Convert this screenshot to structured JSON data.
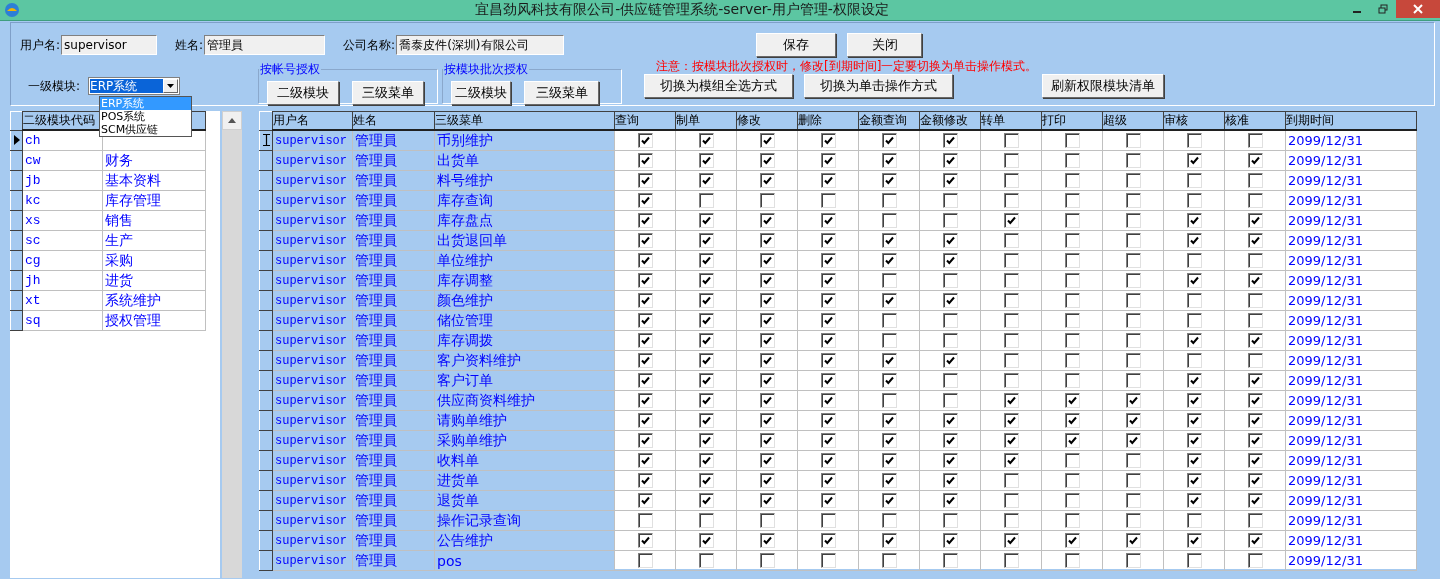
{
  "window": {
    "title": "宜昌劲风科技有限公司-供应链管理系统-server-用户管理-权限设定"
  },
  "fields": [
    {
      "label": "用户名:",
      "value": "supervisor"
    },
    {
      "label": "姓名:",
      "value": "管理員"
    },
    {
      "label": "公司名称:",
      "value": "喬泰皮件(深圳)有限公司"
    }
  ],
  "actions": [
    "保存",
    "关闭"
  ],
  "module": {
    "label": "一级模块:",
    "value": "ERP系统",
    "options": [
      {
        "label": "ERP系统",
        "selected": true
      },
      {
        "label": "POS系统",
        "selected": false
      },
      {
        "label": "SCM供应链",
        "selected": false
      }
    ]
  },
  "groups": [
    {
      "title": "按帐号授权",
      "buttons": [
        "二级模块",
        "三级菜单"
      ]
    },
    {
      "title": "按模块批次授权",
      "buttons": [
        "二级模块",
        "三级菜单"
      ]
    }
  ],
  "notice": "注意：按模块批次授权时，修改[到期时间]一定要切换为单击操作模式。",
  "mode_buttons": [
    "切换为模组全选方式",
    "切换为单击操作方式",
    "刷新权限模块清单"
  ],
  "module_grid": {
    "columns": [
      "二级模块代码"
    ],
    "rows": [
      {
        "code": "ch",
        "selected": true
      },
      {
        "code": "cw",
        "name": "财务",
        "selected": false
      },
      {
        "code": "jb",
        "name": "基本资料",
        "selected": false
      },
      {
        "code": "kc",
        "name": "库存管理",
        "selected": false
      },
      {
        "code": "xs",
        "name": "销售",
        "selected": false
      },
      {
        "code": "sc",
        "name": "生产",
        "selected": false
      },
      {
        "code": "cg",
        "name": "采购",
        "selected": false
      },
      {
        "code": "jh",
        "name": "进货",
        "selected": false
      },
      {
        "code": "xt",
        "name": "系统维护",
        "selected": false
      },
      {
        "code": "sq",
        "name": "授权管理",
        "selected": false
      }
    ]
  },
  "permissions": {
    "columns": [
      "用户名",
      "姓名",
      "三级菜单",
      "查询",
      "制单",
      "修改",
      "删除",
      "金额查询",
      "金额修改",
      "转单",
      "打印",
      "超级",
      "审核",
      "核准",
      "到期时间"
    ],
    "rows": [
      {
        "user": "supervisor",
        "name": "管理員",
        "menu": "币别维护",
        "selected": true,
        "checks": [
          true,
          true,
          true,
          true,
          true,
          true,
          false,
          false,
          false,
          false,
          false
        ],
        "expires": "2099/12/31"
      },
      {
        "user": "supervisor",
        "name": "管理員",
        "menu": "出货单",
        "selected": false,
        "checks": [
          true,
          true,
          true,
          true,
          true,
          true,
          false,
          false,
          false,
          true,
          true
        ],
        "expires": "2099/12/31"
      },
      {
        "user": "supervisor",
        "name": "管理員",
        "menu": "料号维护",
        "selected": false,
        "checks": [
          true,
          true,
          true,
          true,
          true,
          true,
          false,
          false,
          false,
          false,
          false
        ],
        "expires": "2099/12/31"
      },
      {
        "user": "supervisor",
        "name": "管理員",
        "menu": "库存查询",
        "selected": false,
        "checks": [
          true,
          false,
          false,
          false,
          false,
          false,
          false,
          false,
          false,
          false,
          false
        ],
        "expires": "2099/12/31"
      },
      {
        "user": "supervisor",
        "name": "管理員",
        "menu": "库存盘点",
        "selected": false,
        "checks": [
          true,
          true,
          true,
          true,
          false,
          false,
          true,
          false,
          false,
          true,
          true
        ],
        "expires": "2099/12/31"
      },
      {
        "user": "supervisor",
        "name": "管理員",
        "menu": "出货退回单",
        "selected": false,
        "checks": [
          true,
          true,
          true,
          true,
          true,
          true,
          false,
          false,
          false,
          true,
          true
        ],
        "expires": "2099/12/31"
      },
      {
        "user": "supervisor",
        "name": "管理員",
        "menu": "单位维护",
        "selected": false,
        "checks": [
          true,
          true,
          true,
          true,
          true,
          true,
          false,
          false,
          false,
          false,
          false
        ],
        "expires": "2099/12/31"
      },
      {
        "user": "supervisor",
        "name": "管理員",
        "menu": "库存调整",
        "selected": false,
        "checks": [
          true,
          true,
          true,
          true,
          false,
          false,
          false,
          false,
          false,
          true,
          true
        ],
        "expires": "2099/12/31"
      },
      {
        "user": "supervisor",
        "name": "管理員",
        "menu": "颜色维护",
        "selected": false,
        "checks": [
          true,
          true,
          true,
          true,
          true,
          true,
          false,
          false,
          false,
          false,
          false
        ],
        "expires": "2099/12/31"
      },
      {
        "user": "supervisor",
        "name": "管理員",
        "menu": "储位管理",
        "selected": false,
        "checks": [
          true,
          true,
          true,
          true,
          false,
          false,
          false,
          false,
          false,
          false,
          false
        ],
        "expires": "2099/12/31"
      },
      {
        "user": "supervisor",
        "name": "管理員",
        "menu": "库存调拨",
        "selected": false,
        "checks": [
          true,
          true,
          true,
          true,
          false,
          false,
          false,
          false,
          false,
          true,
          true
        ],
        "expires": "2099/12/31"
      },
      {
        "user": "supervisor",
        "name": "管理員",
        "menu": "客户资料维护",
        "selected": false,
        "checks": [
          true,
          true,
          true,
          true,
          true,
          true,
          false,
          false,
          false,
          false,
          false
        ],
        "expires": "2099/12/31"
      },
      {
        "user": "supervisor",
        "name": "管理員",
        "menu": "客户订单",
        "selected": false,
        "checks": [
          true,
          true,
          true,
          true,
          true,
          false,
          false,
          false,
          false,
          true,
          true
        ],
        "expires": "2099/12/31"
      },
      {
        "user": "supervisor",
        "name": "管理員",
        "menu": "供应商资料维护",
        "selected": false,
        "checks": [
          true,
          true,
          true,
          true,
          false,
          false,
          true,
          true,
          true,
          true,
          true
        ],
        "expires": "2099/12/31"
      },
      {
        "user": "supervisor",
        "name": "管理員",
        "menu": "请购单维护",
        "selected": false,
        "checks": [
          true,
          true,
          true,
          true,
          true,
          true,
          true,
          true,
          true,
          true,
          true
        ],
        "expires": "2099/12/31"
      },
      {
        "user": "supervisor",
        "name": "管理員",
        "menu": "采购单维护",
        "selected": false,
        "checks": [
          true,
          true,
          true,
          true,
          true,
          true,
          true,
          true,
          true,
          true,
          true
        ],
        "expires": "2099/12/31"
      },
      {
        "user": "supervisor",
        "name": "管理員",
        "menu": "收料单",
        "selected": false,
        "checks": [
          true,
          true,
          true,
          true,
          true,
          true,
          true,
          false,
          false,
          true,
          true
        ],
        "expires": "2099/12/31"
      },
      {
        "user": "supervisor",
        "name": "管理員",
        "menu": "进货单",
        "selected": false,
        "checks": [
          true,
          true,
          true,
          true,
          true,
          true,
          false,
          false,
          false,
          true,
          true
        ],
        "expires": "2099/12/31"
      },
      {
        "user": "supervisor",
        "name": "管理員",
        "menu": "退货单",
        "selected": false,
        "checks": [
          true,
          true,
          true,
          true,
          true,
          true,
          false,
          false,
          false,
          true,
          true
        ],
        "expires": "2099/12/31"
      },
      {
        "user": "supervisor",
        "name": "管理員",
        "menu": "操作记录查询",
        "selected": false,
        "checks": [
          false,
          false,
          false,
          false,
          false,
          false,
          false,
          false,
          false,
          false,
          false
        ],
        "expires": "2099/12/31"
      },
      {
        "user": "supervisor",
        "name": "管理員",
        "menu": "公告维护",
        "selected": false,
        "checks": [
          true,
          true,
          true,
          true,
          true,
          true,
          true,
          true,
          true,
          true,
          true
        ],
        "expires": "2099/12/31"
      },
      {
        "user": "supervisor",
        "name": "管理員",
        "menu": "pos",
        "selected": false,
        "checks": [
          false,
          false,
          false,
          false,
          false,
          false,
          false,
          false,
          false,
          false,
          false
        ],
        "expires": "2099/12/31"
      }
    ]
  }
}
